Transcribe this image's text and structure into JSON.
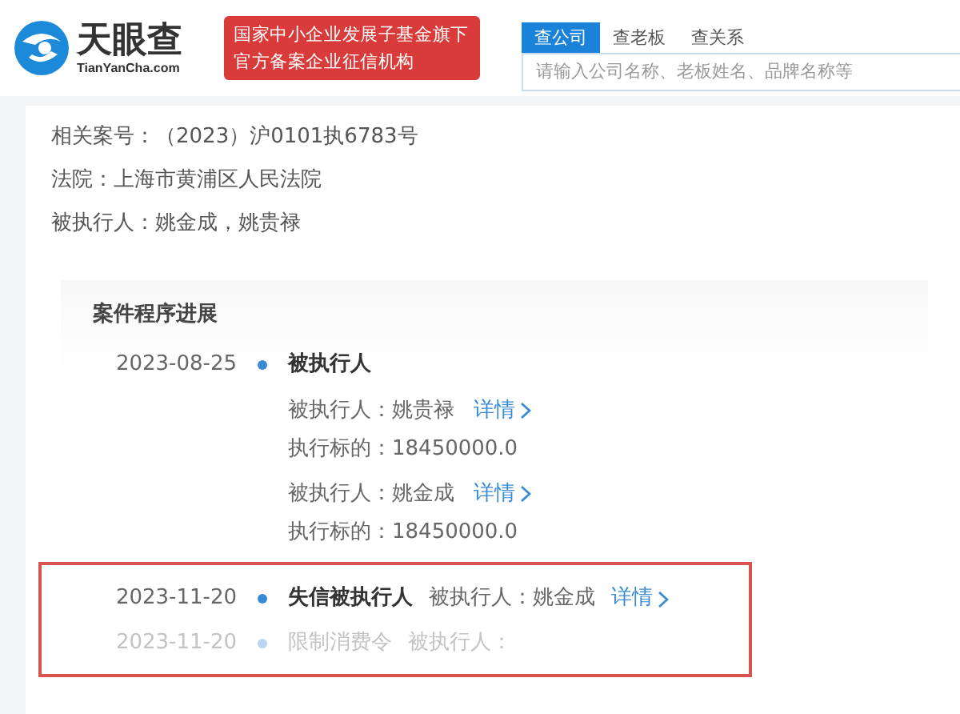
{
  "header": {
    "logo": {
      "name": "天眼查",
      "domain": "TianYanCha.com"
    },
    "banner": [
      "国家中小企业发展子基金旗下",
      "官方备案企业征信机构"
    ],
    "search": {
      "tabs": [
        {
          "label": "查公司",
          "selected": true
        },
        {
          "label": "查老板",
          "selected": false
        },
        {
          "label": "查关系",
          "selected": false
        }
      ],
      "placeholder": "请输入公司名称、老板姓名、品牌名称等"
    }
  },
  "case_info": [
    {
      "label": "相关案号：",
      "value": "（2023）沪0101执6783号"
    },
    {
      "label": "法院：",
      "value": "上海市黄浦区人民法院"
    },
    {
      "label": "被执行人：",
      "value": "姚金成，姚贵禄"
    }
  ],
  "progress": {
    "title": "案件程序进展",
    "entries": [
      {
        "date": "2023-08-25",
        "title": "被执行人",
        "faded": false,
        "details": [
          {
            "label": "被执行人：",
            "value": "姚贵禄",
            "link": "详情",
            "amount_label": "执行标的：",
            "amount": "18450000.0"
          },
          {
            "label": "被执行人：",
            "value": "姚金成",
            "link": "详情",
            "amount_label": "执行标的：",
            "amount": "18450000.0"
          }
        ]
      }
    ],
    "highlighted_entries": [
      {
        "date": "2023-11-20",
        "title": "失信被执行人",
        "faded": false,
        "inline": {
          "label": "被执行人：",
          "value": "姚金成",
          "link": "详情"
        }
      },
      {
        "date": "2023-11-20",
        "title": "限制消费令",
        "faded": true,
        "inline": {
          "label": "被执行人："
        }
      }
    ]
  }
}
